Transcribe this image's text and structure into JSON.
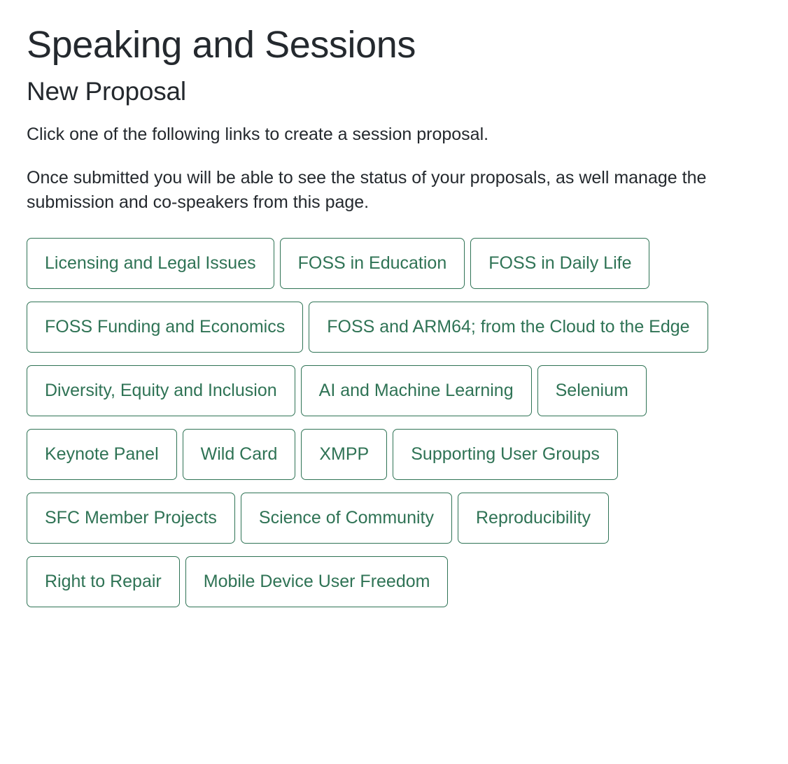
{
  "page": {
    "title": "Speaking and Sessions",
    "section_title": "New Proposal",
    "intro_paragraph_1": "Click one of the following links to create a session proposal.",
    "intro_paragraph_2": "Once submitted you will be able to see the status of your proposals, as well manage the submission and co-speakers from this page.",
    "accent_color": "#2f7355",
    "text_color": "#24292e",
    "background_color": "#ffffff"
  },
  "proposal_links": [
    {
      "label": "Licensing and Legal Issues"
    },
    {
      "label": "FOSS in Education"
    },
    {
      "label": "FOSS in Daily Life"
    },
    {
      "label": "FOSS Funding and Economics"
    },
    {
      "label": "FOSS and ARM64; from the Cloud to the Edge"
    },
    {
      "label": "Diversity, Equity and Inclusion"
    },
    {
      "label": "AI and Machine Learning"
    },
    {
      "label": "Selenium"
    },
    {
      "label": "Keynote Panel"
    },
    {
      "label": "Wild Card"
    },
    {
      "label": "XMPP"
    },
    {
      "label": "Supporting User Groups"
    },
    {
      "label": "SFC Member Projects"
    },
    {
      "label": "Science of Community"
    },
    {
      "label": "Reproducibility"
    },
    {
      "label": "Right to Repair"
    },
    {
      "label": "Mobile Device User Freedom"
    }
  ]
}
